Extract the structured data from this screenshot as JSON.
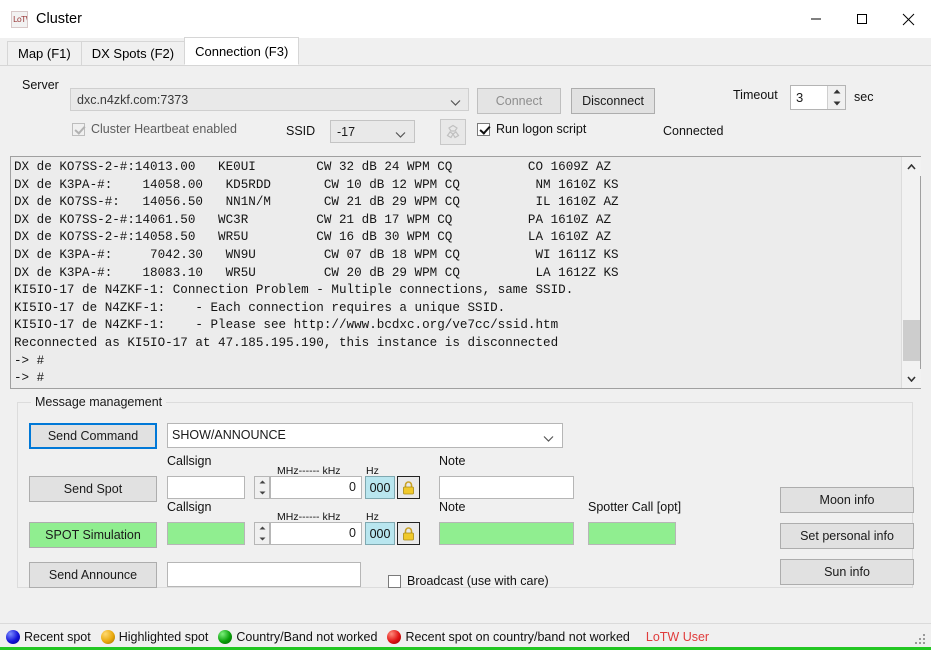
{
  "window": {
    "title": "Cluster",
    "icon": "app-icon",
    "minimize": "minimize",
    "maximize": "maximize",
    "close": "close"
  },
  "tabs": [
    {
      "label": "Map (F1)",
      "active": false
    },
    {
      "label": "DX Spots (F2)",
      "active": false
    },
    {
      "label": "Connection (F3)",
      "active": true
    }
  ],
  "connection": {
    "server_label": "Server",
    "server_value": "dxc.n4zkf.com:7373",
    "connect_label": "Connect",
    "disconnect_label": "Disconnect",
    "timeout_label": "Timeout",
    "timeout_value": "3",
    "sec_label": "sec",
    "heartbeat_label": "Cluster Heartbeat enabled",
    "ssid_label": "SSID",
    "ssid_value": "-17",
    "logon_label": "Run logon script",
    "status_text": "Connected"
  },
  "log": {
    "lines": [
      "DX de KO7SS-2-#:14013.00   KE0UI        CW 32 dB 24 WPM CQ          CO 1609Z AZ",
      "DX de K3PA-#:    14058.00   KD5RDD       CW 10 dB 12 WPM CQ          NM 1610Z KS",
      "DX de KO7SS-#:   14056.50   NN1N/M       CW 21 dB 29 WPM CQ          IL 1610Z AZ",
      "DX de KO7SS-2-#:14061.50   WC3R         CW 21 dB 17 WPM CQ          PA 1610Z AZ",
      "DX de KO7SS-2-#:14058.50   WR5U         CW 16 dB 30 WPM CQ          LA 1610Z AZ",
      "DX de K3PA-#:     7042.30   WN9U         CW 07 dB 18 WPM CQ          WI 1611Z KS",
      "DX de K3PA-#:    18083.10   WR5U         CW 20 dB 29 WPM CQ          LA 1612Z KS",
      "KI5IO-17 de N4ZKF-1: Connection Problem - Multiple connections, same SSID.",
      "KI5IO-17 de N4ZKF-1:    - Each connection requires a unique SSID.",
      "KI5IO-17 de N4ZKF-1:    - Please see http://www.bcdxc.org/ve7cc/ssid.htm",
      "Reconnected as KI5IO-17 at 47.185.195.190, this instance is disconnected",
      "-> #",
      "-> #"
    ]
  },
  "message_management": {
    "caption": "Message management",
    "send_command_label": "Send Command",
    "command_value": "SHOW/ANNOUNCE",
    "send_spot_label": "Send Spot",
    "spot_simulation_label": "SPOT Simulation",
    "send_announce_label": "Send Announce",
    "callsign_label": "Callsign",
    "mhz_khz_label": "MHz------ kHz",
    "hz_label": "Hz",
    "note_label": "Note",
    "spotter_call_label": "Spotter Call [opt]",
    "broadcast_label": "Broadcast (use with care)",
    "spot_freq_value": "0",
    "spot_hz_value": "000",
    "sim_freq_value": "0",
    "sim_hz_value": "000",
    "spot_callsign_value": "",
    "sim_callsign_value": "",
    "spot_note_value": "",
    "sim_note_value": "",
    "sim_spotter_value": "",
    "announce_value": "",
    "lock_icon": "padlock-icon"
  },
  "side_buttons": {
    "moon": "Moon info",
    "personal": "Set personal info",
    "sun": "Sun info"
  },
  "status_bar": {
    "legend": [
      {
        "color": "#1414d8",
        "label": "Recent spot"
      },
      {
        "color": "#e8a80c",
        "label": "Highlighted spot"
      },
      {
        "color": "#0aa00a",
        "label": "Country/Band not worked"
      },
      {
        "color": "#e01414",
        "label": "Recent spot on country/band not worked"
      }
    ],
    "lotw": "LoTW User",
    "lotw_color": "#e03c3c"
  }
}
